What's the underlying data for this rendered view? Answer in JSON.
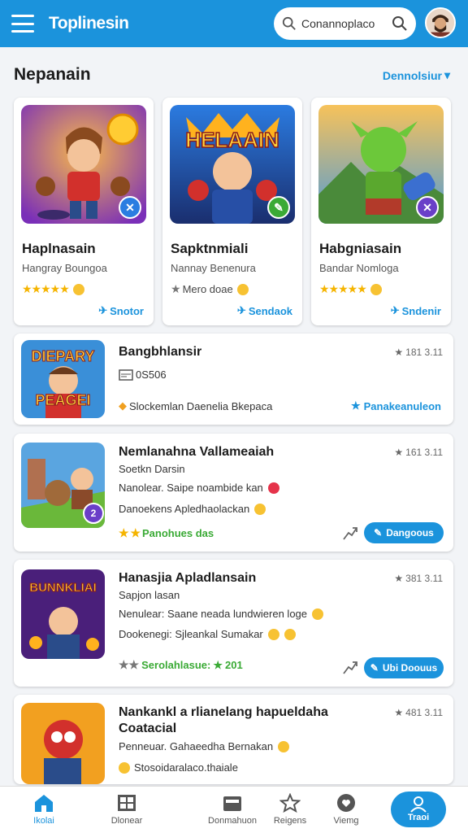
{
  "header": {
    "title": "Toplinesin",
    "search_value": "Conannoplaco",
    "brand_color": "#1b93dc"
  },
  "section": {
    "title": "Nepanain",
    "link_label": "Dennolsiur"
  },
  "featured": [
    {
      "name": "Haplnasain",
      "subtitle": "Hangray Boungoa",
      "rating_text": "",
      "stars": 5,
      "action": "Snotor",
      "thumb_title": "",
      "badge_color": "#2a7de1",
      "badge_icon": "tool-icon"
    },
    {
      "name": "Sapktnmiali",
      "subtitle": "Nannay Benenura",
      "rating_text": "Mero doae",
      "stars": 1,
      "action": "Sendaok",
      "thumb_title": "HELAAIN",
      "badge_color": "#3aaa35",
      "badge_icon": "wrench-icon"
    },
    {
      "name": "Habgniasain",
      "subtitle": "Bandar Nomloga",
      "rating_text": "",
      "stars": 5,
      "action": "Sndenir",
      "thumb_title": "",
      "badge_color": "#6a3fc8",
      "badge_icon": "tool-icon"
    }
  ],
  "list": [
    {
      "title": "Bangbhlansir",
      "meta": "181 3.11",
      "line1": "0S506",
      "line2": "Slockemlan Daenelia Bkepaca",
      "action": "Panakeanuleon",
      "thumb_title_top": "DIEPARY",
      "thumb_title_bottom": "PEAGEI"
    },
    {
      "title": "Nemlanahna Vallameaiah",
      "meta": "161 3.11",
      "line1": "Soetkn Darsin",
      "line2": "Nanolear. Saipe noambide kan",
      "line3": "Danoekens Apledhaolackan",
      "line4": "Panohues das",
      "button": "Dangoous"
    },
    {
      "title": "Hanasjia Apladlansain",
      "meta": "381 3.11",
      "line1": "Sapjon lasan",
      "line2": "Nenulear: Saane neada lundwieren loge",
      "line3": "Dookenegi: Sjleankal Sumakar",
      "line4": "Serolahlasue:",
      "line4b": "201",
      "button": "Ubi Doouus",
      "thumb_title": "BUNNKLIAI"
    },
    {
      "title": "Nankankl a rlianelang hapueldaha",
      "title2": "Coatacial",
      "meta": "481 3.11",
      "line1": "Penneuar. Gahaeedha Bernakan",
      "line2": "Stosoidaralaco.thaiale"
    }
  ],
  "nav": [
    {
      "label": "Ikolai",
      "icon": "home-icon",
      "active": true
    },
    {
      "label": "Dlonear",
      "icon": "book-icon",
      "active": false
    },
    {
      "label": "Donmahuon",
      "icon": "folder-icon",
      "active": false
    },
    {
      "label": "Reigens",
      "icon": "star-icon",
      "active": false
    },
    {
      "label": "Viemg",
      "icon": "heart-icon",
      "active": false
    },
    {
      "label": "Traoi",
      "icon": "user-icon",
      "active": false
    }
  ]
}
